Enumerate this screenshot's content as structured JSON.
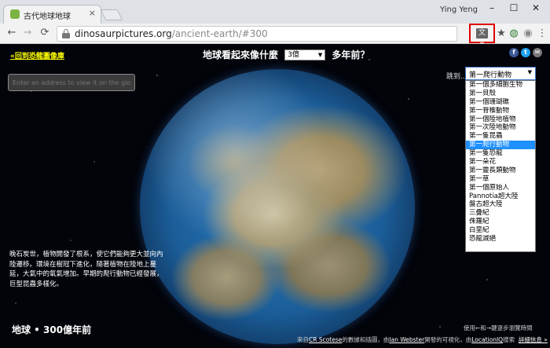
{
  "browser": {
    "tab_title": "古代地球地球",
    "tab_close": "×",
    "user_name": "Ying Yeng",
    "window_controls": [
      "–",
      "☐",
      "✕"
    ],
    "url_domain": "dinosaurpictures.org",
    "url_path": "/ancient-earth/#300",
    "translate_icon_label": "文A",
    "icons": [
      "back-arrow-icon",
      "forward-arrow-icon",
      "reload-icon",
      "lock-icon",
      "translate-icon",
      "star-icon",
      "extension-icon",
      "account-icon",
      "menu-icon"
    ]
  },
  "page": {
    "back_link": "«回到恐龍圖像庫",
    "header_pre": "地球看起來像什麼",
    "year_value": "3億",
    "header_post": "多年前？",
    "social": [
      "f",
      "t",
      "✉"
    ],
    "address_placeholder": "Enter an address to view it on the globe",
    "jump_label": "跳到...",
    "jump_selected": "第一爬行動物",
    "jump_options": [
      "第一個多細胞生物",
      "第一貝殼",
      "第一個珊瑚礁",
      "第一脊椎動物",
      "第一個陸地植物",
      "第一次陸地動物",
      "第一隻昆蟲",
      "第一爬行動物",
      "第一隻恐龍",
      "第一朵花",
      "第一靈長類動物",
      "第一草",
      "第一個原始人",
      "Pannotia超大陸",
      "盤古超大陸",
      "三疊紀",
      "侏羅紀",
      "白堊紀",
      "恐龍滅絕"
    ],
    "description": "晚石炭世，植物開發了根系，使它們能夠更大並向內陸遷移。環境在樹冠下進化，隨著植物在陸地上蔓延，大氣中的氧氣增加。早期的爬行動物已經發展，巨型昆蟲多樣化。",
    "earth_age": "地球 • 300億年前",
    "hint": "使用←和→鍵逐步瀏覽時間",
    "credits_prefix": "來自",
    "credits_cr": "CR Scotese",
    "credits_mid1": "的數據和插圖，由",
    "credits_ian": "Ian Webster",
    "credits_mid2": "開發的可視化，由",
    "credits_loc": "LocationIQ",
    "credits_mid3": "搜索",
    "credits_more": "詳細信息 »"
  },
  "colors": {
    "highlight": "#1e90ff",
    "link_yellow": "#ffff00",
    "translate_box": "#e00000"
  }
}
